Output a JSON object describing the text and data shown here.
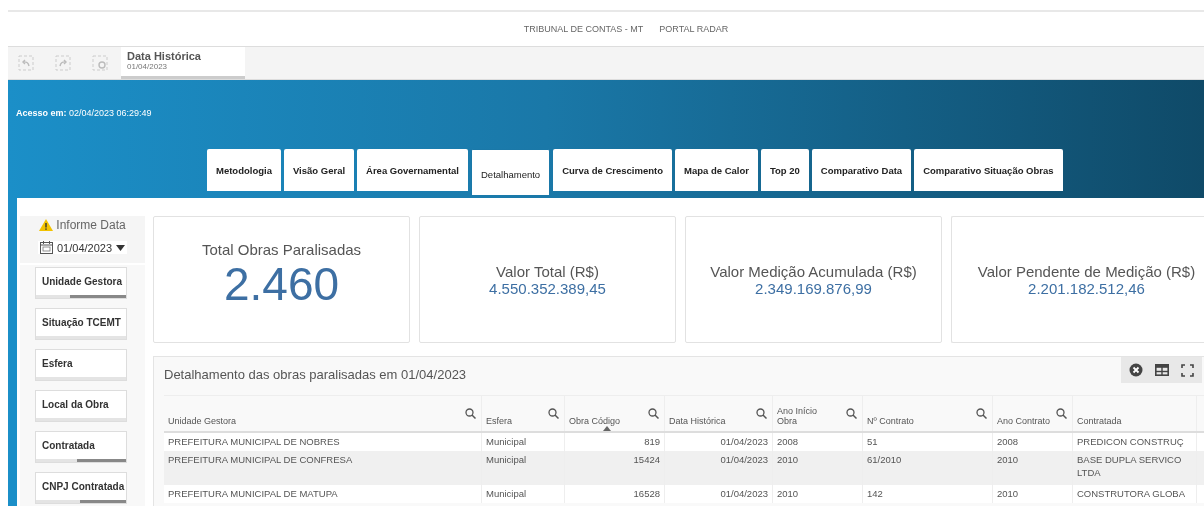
{
  "header": {
    "links": [
      "TRIBUNAL DE CONTAS - MT",
      "PORTAL RADAR"
    ]
  },
  "toolbar": {
    "selection_tab": {
      "label": "Data Histórica",
      "value": "01/04/2023"
    }
  },
  "banner": {
    "access_label": "Acesso em:",
    "access_value": "02/04/2023 06:29:49"
  },
  "tabs": [
    {
      "label": "Metodologia",
      "selected": false
    },
    {
      "label": "Visão Geral",
      "selected": false
    },
    {
      "label": "Área Governamental",
      "selected": false
    },
    {
      "label": "Detalhamento",
      "selected": true
    },
    {
      "label": "Curva de Crescimento",
      "selected": false
    },
    {
      "label": "Mapa de Calor",
      "selected": false
    },
    {
      "label": "Top 20",
      "selected": false
    },
    {
      "label": "Comparativo Data",
      "selected": false
    },
    {
      "label": "Comparativo Situação Obras",
      "selected": false
    }
  ],
  "sidebar": {
    "warning": "Informe Data",
    "date": "01/04/2023",
    "filters": [
      {
        "label": "Unidade Gestora",
        "level": 0.62
      },
      {
        "label": "Situação TCEMT"
      },
      {
        "label": "Esfera"
      },
      {
        "label": "Local da Obra"
      },
      {
        "label": "Contratada",
        "level": 0.54
      },
      {
        "label": "CNPJ Contratada",
        "level": 0.51
      }
    ]
  },
  "kpis": [
    {
      "kind": "big",
      "title": "Total Obras Paralisadas",
      "value": "2.460"
    },
    {
      "kind": "money",
      "title": "Valor Total (R$)",
      "value": "4.550.352.389,45"
    },
    {
      "kind": "money",
      "title": "Valor Medição Acumulada (R$)",
      "value": "2.349.169.876,99"
    },
    {
      "kind": "money",
      "title": "Valor Pendente de Medição (R$)",
      "value": "2.201.182.512,46"
    }
  ],
  "table": {
    "title": "Detalhamento das obras paralisadas em 01/04/2023",
    "columns": [
      {
        "label": "Unidade Gestora",
        "search": true,
        "sorted": false
      },
      {
        "label": "Esfera",
        "search": true,
        "sorted": false
      },
      {
        "label": "Obra Código",
        "search": true,
        "sorted": true
      },
      {
        "label": "Data Histórica",
        "search": true,
        "sorted": false
      },
      {
        "label": "Ano Início Obra",
        "search": true,
        "sorted": false
      },
      {
        "label": "Nº Contrato",
        "search": true,
        "sorted": false
      },
      {
        "label": "Ano Contrato",
        "search": true,
        "sorted": false
      },
      {
        "label": "Contratada",
        "search": false,
        "sorted": false
      }
    ],
    "rows": [
      {
        "cells": [
          "PREFEITURA MUNICIPAL DE NOBRES",
          "Municipal",
          "819",
          "01/04/2023",
          "2008",
          "51",
          "2008",
          "PREDICON CONSTRUÇ"
        ],
        "selected": false
      },
      {
        "cells": [
          "PREFEITURA MUNICIPAL DE CONFRESA",
          "Municipal",
          "15424",
          "01/04/2023",
          "2010",
          "61/2010",
          "2010",
          "BASE DUPLA SERVICO LTDA"
        ],
        "selected": true
      },
      {
        "cells": [
          "PREFEITURA MUNICIPAL DE MATUPA",
          "Municipal",
          "16528",
          "01/04/2023",
          "2010",
          "142",
          "2010",
          "CONSTRUTORA GLOBA"
        ],
        "selected": false
      }
    ]
  }
}
